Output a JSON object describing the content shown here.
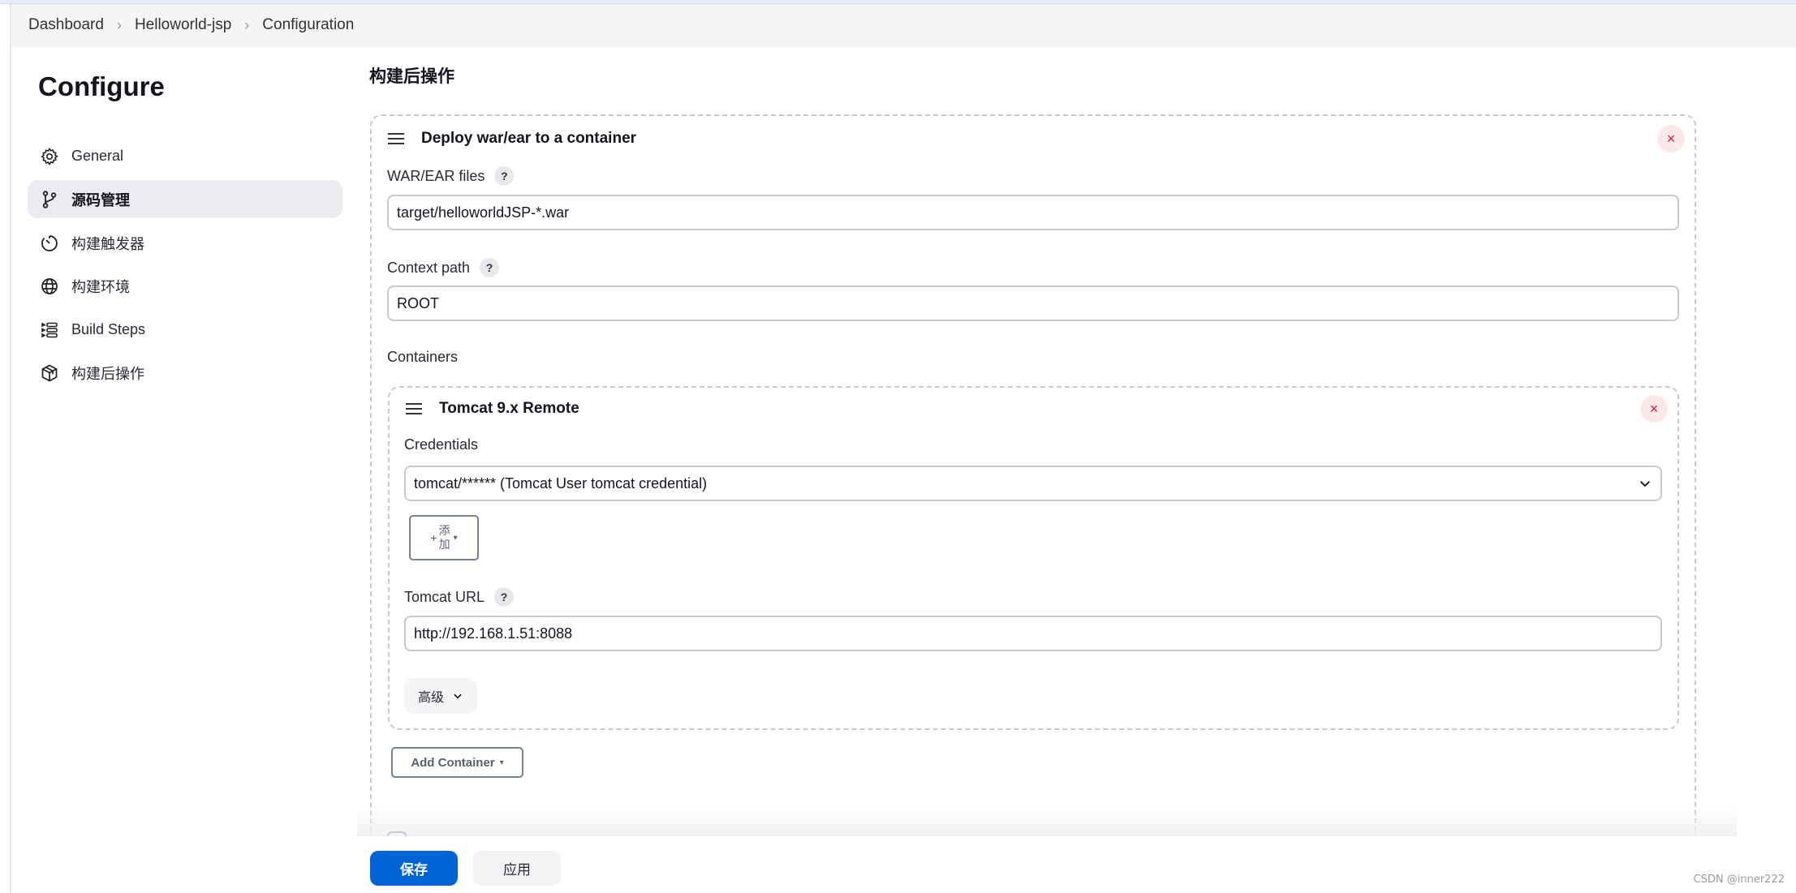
{
  "breadcrumb": {
    "items": [
      "Dashboard",
      "Helloworld-jsp",
      "Configuration"
    ],
    "separator_icon": "chevron-right-icon"
  },
  "sidebar": {
    "title": "Configure",
    "items": [
      {
        "label": "General",
        "icon": "gear-icon",
        "active": false
      },
      {
        "label": "源码管理",
        "icon": "git-branch-icon",
        "active": true
      },
      {
        "label": "构建触发器",
        "icon": "timer-icon",
        "active": false
      },
      {
        "label": "构建环境",
        "icon": "globe-icon",
        "active": false
      },
      {
        "label": "Build Steps",
        "icon": "list-steps-icon",
        "active": false
      },
      {
        "label": "构建后操作",
        "icon": "package-icon",
        "active": false
      }
    ]
  },
  "main": {
    "section_title": "构建后操作",
    "deploy_block": {
      "title": "Deploy war/ear to a container",
      "close_symbol": "×",
      "war_files": {
        "label": "WAR/EAR files",
        "help": "?",
        "value": "target/helloworldJSP-*.war"
      },
      "context_path": {
        "label": "Context path",
        "help": "?",
        "value": "ROOT"
      },
      "containers_label": "Containers",
      "container": {
        "title": "Tomcat 9.x Remote",
        "close_symbol": "×",
        "credentials": {
          "label": "Credentials",
          "selected": "tomcat/****** (Tomcat User tomcat credential)"
        },
        "add_button": {
          "plus": "+",
          "line1": "添",
          "line2": "加",
          "caret": "▾"
        },
        "tomcat_url": {
          "label": "Tomcat URL",
          "help": "?",
          "value": "http://192.168.1.51:8088"
        },
        "advanced_label": "高级"
      },
      "add_container": {
        "label": "Add Container",
        "caret": "▾"
      }
    }
  },
  "footer": {
    "save_label": "保存",
    "apply_label": "应用"
  },
  "watermark": "CSDN @inner222",
  "colors": {
    "primary": "#0063d3",
    "danger": "#e0163a",
    "danger_bg": "#fbe9ea",
    "active_bg": "#ebecf2"
  }
}
